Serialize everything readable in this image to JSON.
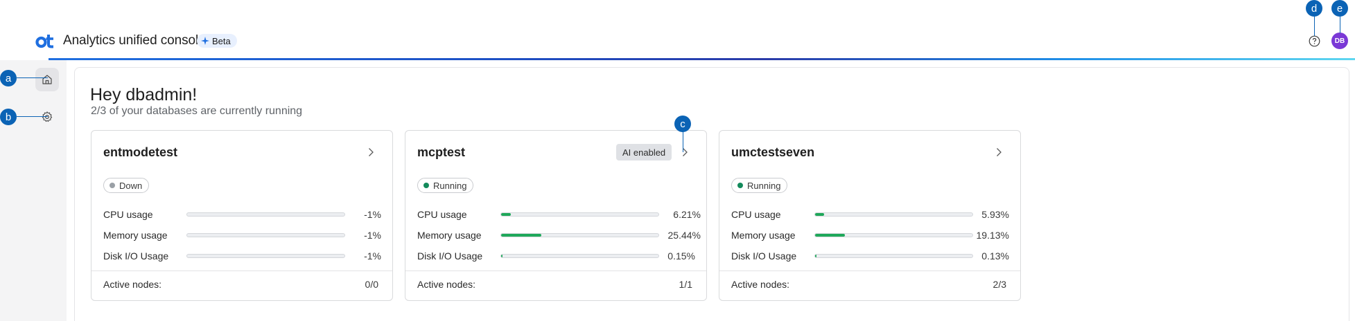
{
  "header": {
    "title": "Analytics unified console",
    "beta_label": "Beta",
    "avatar_initials": "DB",
    "logo_icon": "ot-logo-icon",
    "help_icon": "help-circle-icon"
  },
  "callouts": {
    "a": "a",
    "b": "b",
    "c": "c",
    "d": "d",
    "e": "e"
  },
  "sidebar": {
    "items": [
      {
        "icon": "home-icon",
        "active": true
      },
      {
        "icon": "gear-icon",
        "active": false
      }
    ]
  },
  "main": {
    "greeting": "Hey dbadmin!",
    "subtitle": "2/3 of your databases are currently running"
  },
  "metric_labels": {
    "cpu": "CPU usage",
    "memory": "Memory usage",
    "disk": "Disk I/O Usage",
    "active_nodes": "Active nodes:"
  },
  "cards": [
    {
      "name": "entmodetest",
      "status": "Down",
      "status_color": "#9aa0a6",
      "ai_badge": "",
      "cpu": {
        "text": "-1%",
        "percent": 0
      },
      "memory": {
        "text": "-1%",
        "percent": 0
      },
      "disk": {
        "text": "-1%",
        "percent": 0
      },
      "active_nodes": "0/0"
    },
    {
      "name": "mcptest",
      "status": "Running",
      "status_color": "#138a5b",
      "ai_badge": "AI enabled",
      "cpu": {
        "text": "6.21%",
        "percent": 6.21
      },
      "memory": {
        "text": "25.44%",
        "percent": 25.44
      },
      "disk": {
        "text": "0.15%",
        "percent": 0.15
      },
      "active_nodes": "1/1"
    },
    {
      "name": "umctestseven",
      "status": "Running",
      "status_color": "#138a5b",
      "ai_badge": "",
      "cpu": {
        "text": "5.93%",
        "percent": 5.93
      },
      "memory": {
        "text": "19.13%",
        "percent": 19.13
      },
      "disk": {
        "text": "0.13%",
        "percent": 0.13
      },
      "active_nodes": "2/3"
    }
  ],
  "colors": {
    "accent": "#1f6fe0",
    "callout": "#0b63b5",
    "avatar": "#7a38d6",
    "progress": "#1fa85a"
  }
}
